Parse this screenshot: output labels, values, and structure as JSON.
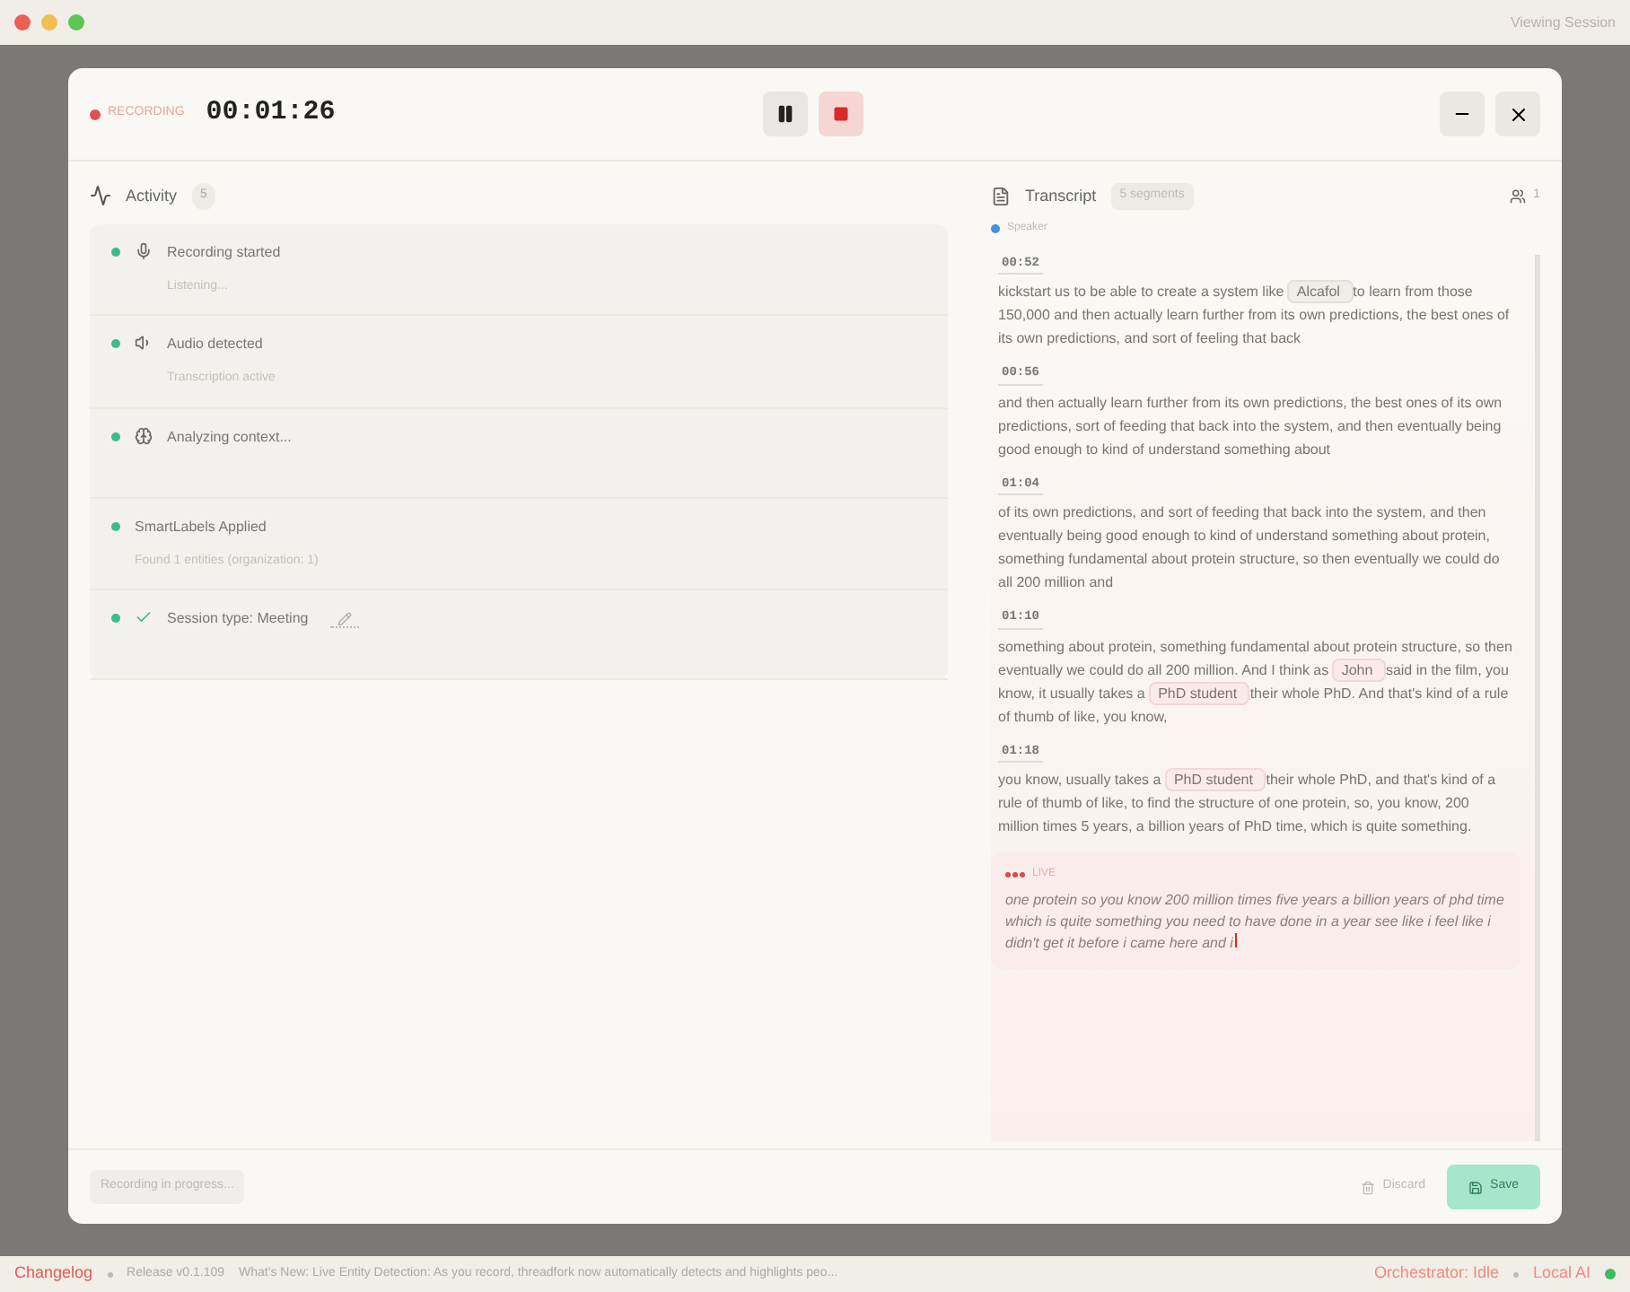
{
  "titlebar": {
    "status": "Viewing Session"
  },
  "header": {
    "recording_label": "RECORDING",
    "timer": "00:01:26"
  },
  "activity": {
    "title": "Activity",
    "count": "5",
    "items": [
      {
        "kind": "mic",
        "title": "Recording started",
        "detail": "Listening..."
      },
      {
        "kind": "audio",
        "title": "Audio detected",
        "detail": "Transcription active"
      },
      {
        "kind": "brain",
        "title": "Analyzing context..."
      },
      {
        "kind": "none",
        "title": "SmartLabels Applied",
        "detail": "Found 1 entities (organization: 1)"
      },
      {
        "kind": "check",
        "title": "Session type: Meeting",
        "editable": true
      }
    ]
  },
  "transcript": {
    "title": "Transcript",
    "count": "5 segments",
    "speakers": "1",
    "speaker_label": "Speaker",
    "segments": [
      {
        "time": "00:52",
        "parts": [
          {
            "kind": "text",
            "text": "kickstart us to be able to create a system like"
          },
          {
            "kind": "organization",
            "text": "Alcafol"
          },
          {
            "kind": "text",
            "text": "to learn from those 150,000 and then actually learn further from its own predictions, the best ones of its own predictions, and sort of feeling that back"
          }
        ]
      },
      {
        "time": "00:56",
        "parts": [
          {
            "kind": "text",
            "text": "and then actually learn further from its own predictions, the best ones of its own predictions, sort of feeding that back into the system, and then eventually being good enough to kind of understand something about"
          }
        ]
      },
      {
        "time": "01:04",
        "parts": [
          {
            "kind": "text",
            "text": "of its own predictions, and sort of feeding that back into the system, and then eventually being good enough to kind of understand something about protein, something fundamental about protein structure, so then eventually we could do all 200 million and"
          }
        ]
      },
      {
        "time": "01:10",
        "parts": [
          {
            "kind": "text",
            "text": "something about protein, something fundamental about protein structure, so then eventually we could do all 200 million. And I think as"
          },
          {
            "kind": "person",
            "text": "John"
          },
          {
            "kind": "text",
            "text": "said in the film, you know, it usually takes a"
          },
          {
            "kind": "person",
            "text": "PhD student"
          },
          {
            "kind": "text",
            "text": "their whole PhD. And that's kind of a rule of thumb of like, you know,"
          }
        ]
      },
      {
        "time": "01:18",
        "parts": [
          {
            "kind": "text",
            "text": "you know, usually takes a"
          },
          {
            "kind": "person",
            "text": "PhD student"
          },
          {
            "kind": "text",
            "text": "their whole PhD, and that's kind of a rule of thumb of like, to find the structure of one protein, so, you know, 200 million times 5 years, a billion years of PhD time, which is quite something."
          }
        ]
      }
    ],
    "live": {
      "label": "LIVE",
      "text": "one protein so you know 200 million times five years a billion years of phd time which is quite something you need to have done in a year see like i feel like i didn't get it before i came here and i"
    }
  },
  "footer": {
    "status": "Recording in progress...",
    "discard": "Discard",
    "save": "Save"
  },
  "statusbar": {
    "changelog": "Changelog",
    "release": "Release v0.1.109",
    "news": "What's New: Live Entity Detection: As you record, threadfork now automatically detects and highlights peo...",
    "orchestrator": "Orchestrator: Idle",
    "local": "Local AI",
    "local_on": true
  }
}
